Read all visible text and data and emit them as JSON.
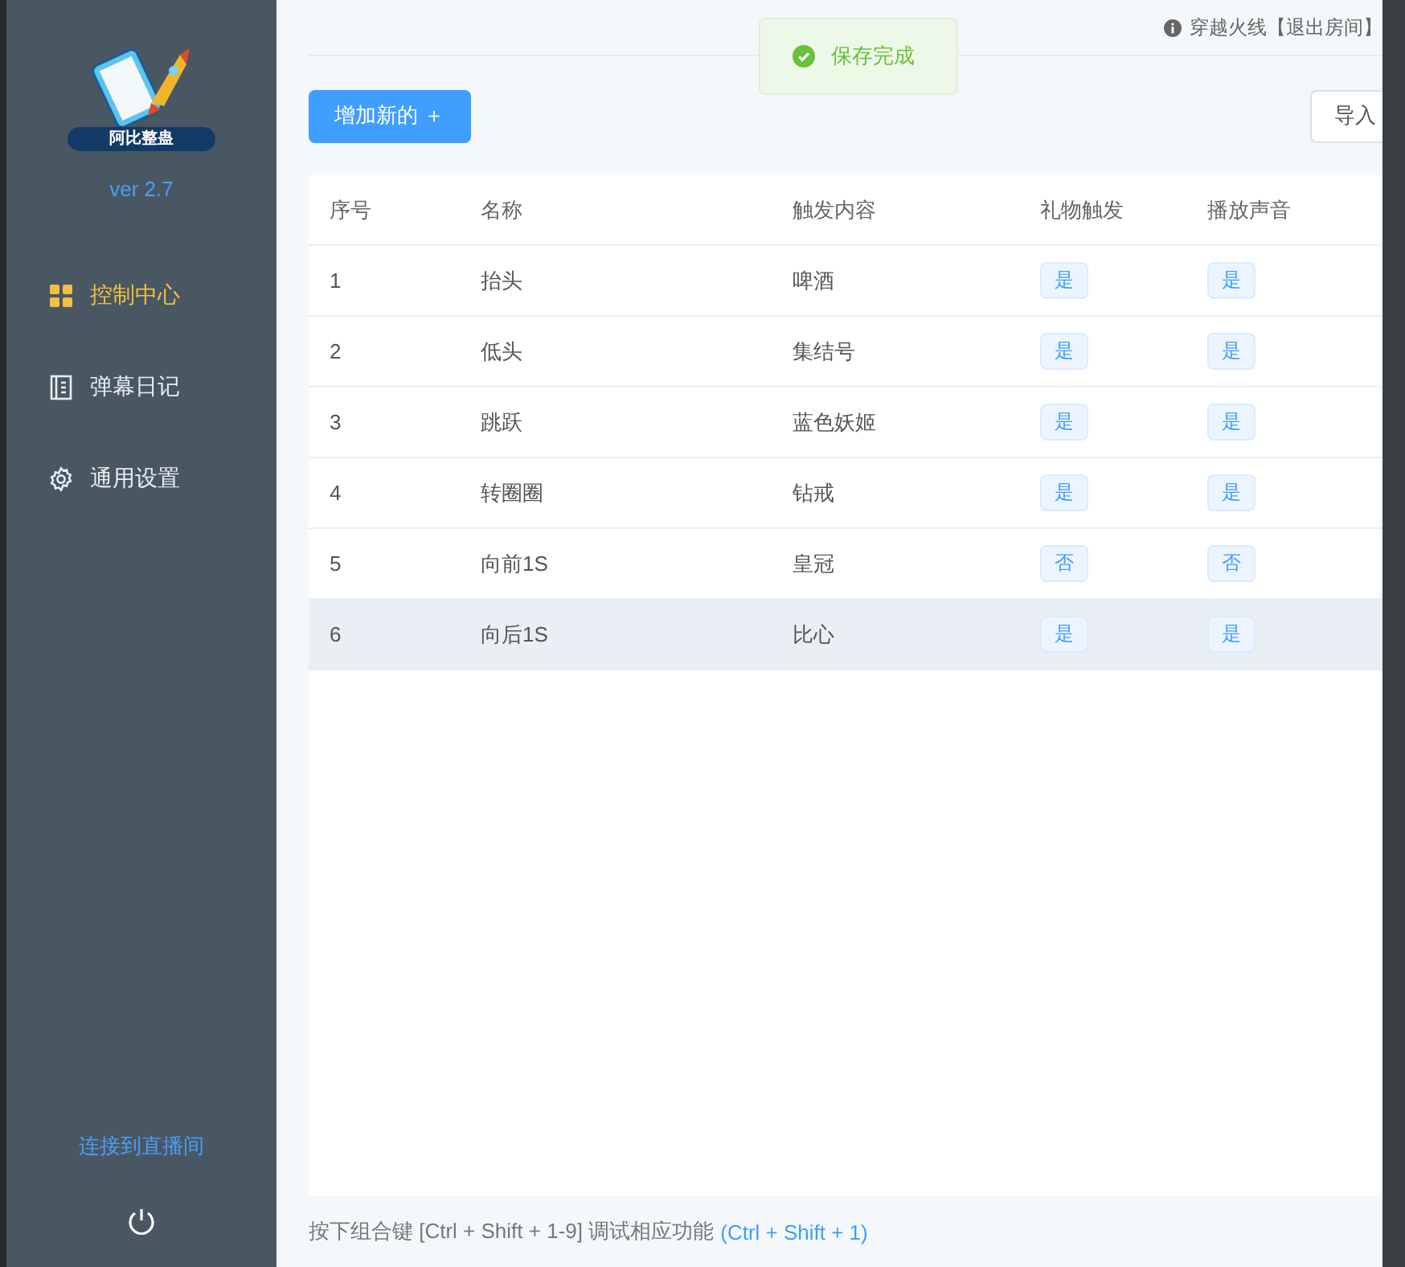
{
  "sidebar": {
    "logo_text": "阿比整蛊",
    "version": "ver 2.7",
    "items": [
      {
        "label": "控制中心",
        "selected": true
      },
      {
        "label": "弹幕日记",
        "selected": false
      },
      {
        "label": "通用设置",
        "selected": false
      }
    ],
    "connect_link": "连接到直播间"
  },
  "toast": {
    "text": "保存完成"
  },
  "notice": "穿越火线【退出房间】",
  "toolbar": {
    "add_button": "增加新的 ＋",
    "import_button": "导入"
  },
  "table": {
    "columns": [
      "序号",
      "名称",
      "触发内容",
      "礼物触发",
      "播放声音"
    ],
    "rows": [
      {
        "index": "1",
        "name": "抬头",
        "trigger": "啤酒",
        "gift": "是",
        "sound": "是",
        "selected": false
      },
      {
        "index": "2",
        "name": "低头",
        "trigger": "集结号",
        "gift": "是",
        "sound": "是",
        "selected": false
      },
      {
        "index": "3",
        "name": "跳跃",
        "trigger": "蓝色妖姬",
        "gift": "是",
        "sound": "是",
        "selected": false
      },
      {
        "index": "4",
        "name": "转圈圈",
        "trigger": "钻戒",
        "gift": "是",
        "sound": "是",
        "selected": false
      },
      {
        "index": "5",
        "name": "向前1S",
        "trigger": "皇冠",
        "gift": "否",
        "sound": "否",
        "selected": false
      },
      {
        "index": "6",
        "name": "向后1S",
        "trigger": "比心",
        "gift": "是",
        "sound": "是",
        "selected": true
      }
    ]
  },
  "footer": {
    "hint": "按下组合键 [Ctrl + Shift + 1-9] 调试相应功能",
    "shortcut": "(Ctrl + Shift + 1)"
  }
}
